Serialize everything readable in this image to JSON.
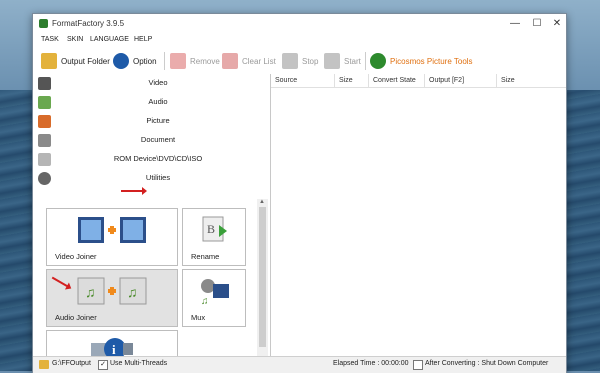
{
  "window": {
    "title": "FormatFactory 3.9.5"
  },
  "menu": [
    "TASK",
    "SKIN",
    "LANGUAGE",
    "HELP"
  ],
  "toolbar": {
    "output_folder": "Output Folder",
    "option": "Option",
    "remove": "Remove",
    "clear_list": "Clear List",
    "stop": "Stop",
    "start": "Start",
    "picosmos": "Picosmos Picture Tools"
  },
  "categories": {
    "video": "Video",
    "audio": "Audio",
    "picture": "Picture",
    "document": "Document",
    "rom": "ROM Device\\DVD\\CD\\ISO",
    "utilities": "Utilities"
  },
  "tools": {
    "video_joiner": "Video Joiner",
    "rename": "Rename",
    "audio_joiner": "Audio Joiner",
    "mux": "Mux"
  },
  "columns": [
    "Source",
    "Size",
    "Convert State",
    "Output [F2]",
    "Size"
  ],
  "status": {
    "output_path": "G:\\FFOutput",
    "multi_threads": "Use Multi-Threads",
    "elapsed": "Elapsed Time : 00:00:00",
    "after_converting": "After Converting : Shut Down Computer"
  },
  "colors": {
    "accent_green": "#2d8a2d",
    "picosmos_orange": "#e07010",
    "arrow_red": "#d32020"
  }
}
